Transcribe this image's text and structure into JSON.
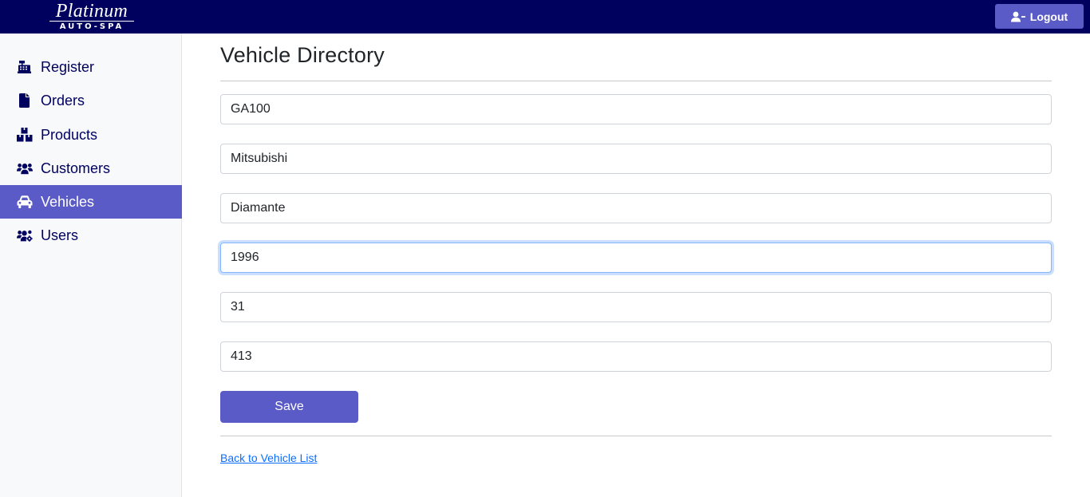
{
  "header": {
    "logo_script": "Platinum",
    "logo_sub": "AUTO-SPA",
    "logout_label": "Logout",
    "logout_icon": "user-minus-icon"
  },
  "sidebar": {
    "items": [
      {
        "label": "Register",
        "icon": "cash-register-icon",
        "active": false
      },
      {
        "label": "Orders",
        "icon": "file-icon",
        "active": false
      },
      {
        "label": "Products",
        "icon": "boxes-icon",
        "active": false
      },
      {
        "label": "Customers",
        "icon": "users-icon",
        "active": false
      },
      {
        "label": "Vehicles",
        "icon": "car-icon",
        "active": true
      },
      {
        "label": "Users",
        "icon": "users-cog-icon",
        "active": false
      }
    ]
  },
  "main": {
    "title": "Vehicle Directory",
    "fields": {
      "field_1": "GA100",
      "field_2": "Mitsubishi",
      "field_3": "Diamante",
      "field_4": "1996",
      "field_5": "31",
      "field_6": "413"
    },
    "save_label": "Save",
    "back_link": "Back to Vehicle List"
  },
  "colors": {
    "header_bg": "#00005f",
    "accent": "#5b5bc8",
    "sidebar_text": "#00005f",
    "link": "#0d6efd"
  }
}
